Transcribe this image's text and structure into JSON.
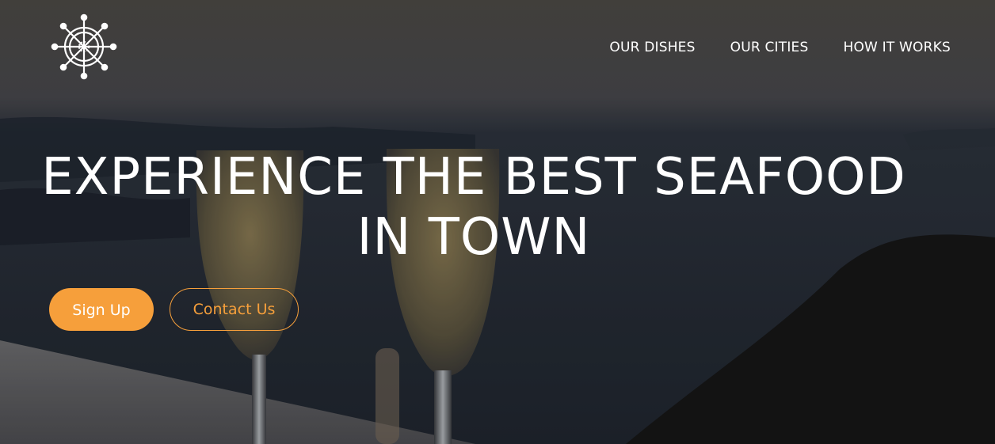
{
  "brand": {
    "logo_icon": "ship-wheel-icon"
  },
  "nav": {
    "items": [
      {
        "label": "OUR DISHES"
      },
      {
        "label": "OUR CITIES"
      },
      {
        "label": "HOW IT WORKS"
      }
    ]
  },
  "hero": {
    "headline_line1": "EXPERIENCE THE BEST SEAFOOD",
    "headline_line2": "IN TOWN",
    "background_icon": "champagne-glasses-sea-photo"
  },
  "actions": {
    "signup_label": "Sign Up",
    "contact_label": "Contact Us"
  },
  "colors": {
    "accent": "#f69f3b",
    "text": "#ffffff"
  }
}
